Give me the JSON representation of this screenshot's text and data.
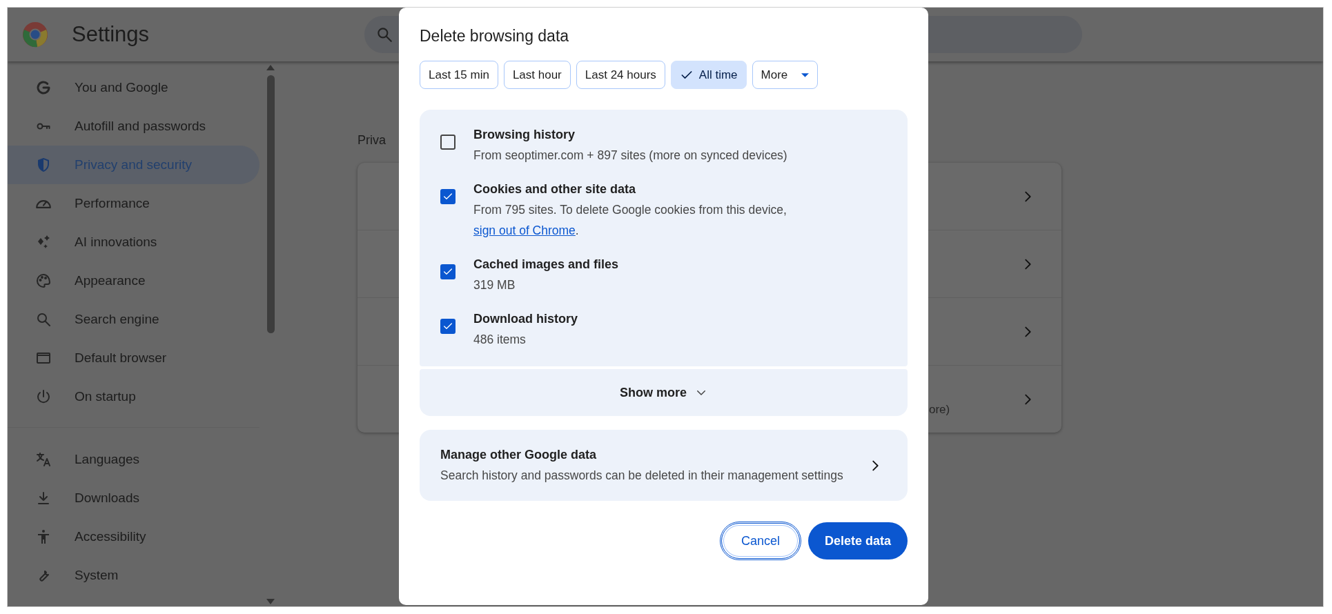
{
  "app": {
    "title": "Settings"
  },
  "sidebar": {
    "groups": [
      {
        "items": [
          {
            "label": "You and Google",
            "selected": false
          },
          {
            "label": "Autofill and passwords",
            "selected": false
          },
          {
            "label": "Privacy and security",
            "selected": true
          },
          {
            "label": "Performance",
            "selected": false
          },
          {
            "label": "AI innovations",
            "selected": false
          },
          {
            "label": "Appearance",
            "selected": false
          },
          {
            "label": "Search engine",
            "selected": false
          },
          {
            "label": "Default browser",
            "selected": false
          },
          {
            "label": "On startup",
            "selected": false
          }
        ]
      },
      {
        "items": [
          {
            "label": "Languages",
            "selected": false
          },
          {
            "label": "Downloads",
            "selected": false
          },
          {
            "label": "Accessibility",
            "selected": false
          },
          {
            "label": "System",
            "selected": false
          }
        ]
      }
    ]
  },
  "main": {
    "heading": "Priva",
    "card": {
      "trailing_text": "ore)"
    }
  },
  "dialog": {
    "title": "Delete browsing data",
    "time_ranges": [
      {
        "label": "Last 15 min",
        "selected": false,
        "kind": "chip"
      },
      {
        "label": "Last hour",
        "selected": false,
        "kind": "chip"
      },
      {
        "label": "Last 24 hours",
        "selected": false,
        "kind": "chip"
      },
      {
        "label": "All time",
        "selected": true,
        "kind": "chip"
      },
      {
        "label": "More",
        "selected": false,
        "kind": "dropdown"
      }
    ],
    "options": [
      {
        "title": "Browsing history",
        "description": "From seoptimer.com + 897 sites (more on synced devices)",
        "checked": false
      },
      {
        "title": "Cookies and other site data",
        "description": "From 795 sites. To delete Google cookies from this device,",
        "link": "sign out of Chrome",
        "description_end": ".",
        "checked": true
      },
      {
        "title": "Cached images and files",
        "description": "319 MB",
        "checked": true
      },
      {
        "title": "Download history",
        "description": "486 items",
        "checked": true
      }
    ],
    "show_more": "Show more",
    "manage": {
      "title": "Manage other Google data",
      "description": "Search history and passwords can be deleted in their management settings"
    },
    "buttons": {
      "cancel": "Cancel",
      "confirm": "Delete data"
    }
  }
}
